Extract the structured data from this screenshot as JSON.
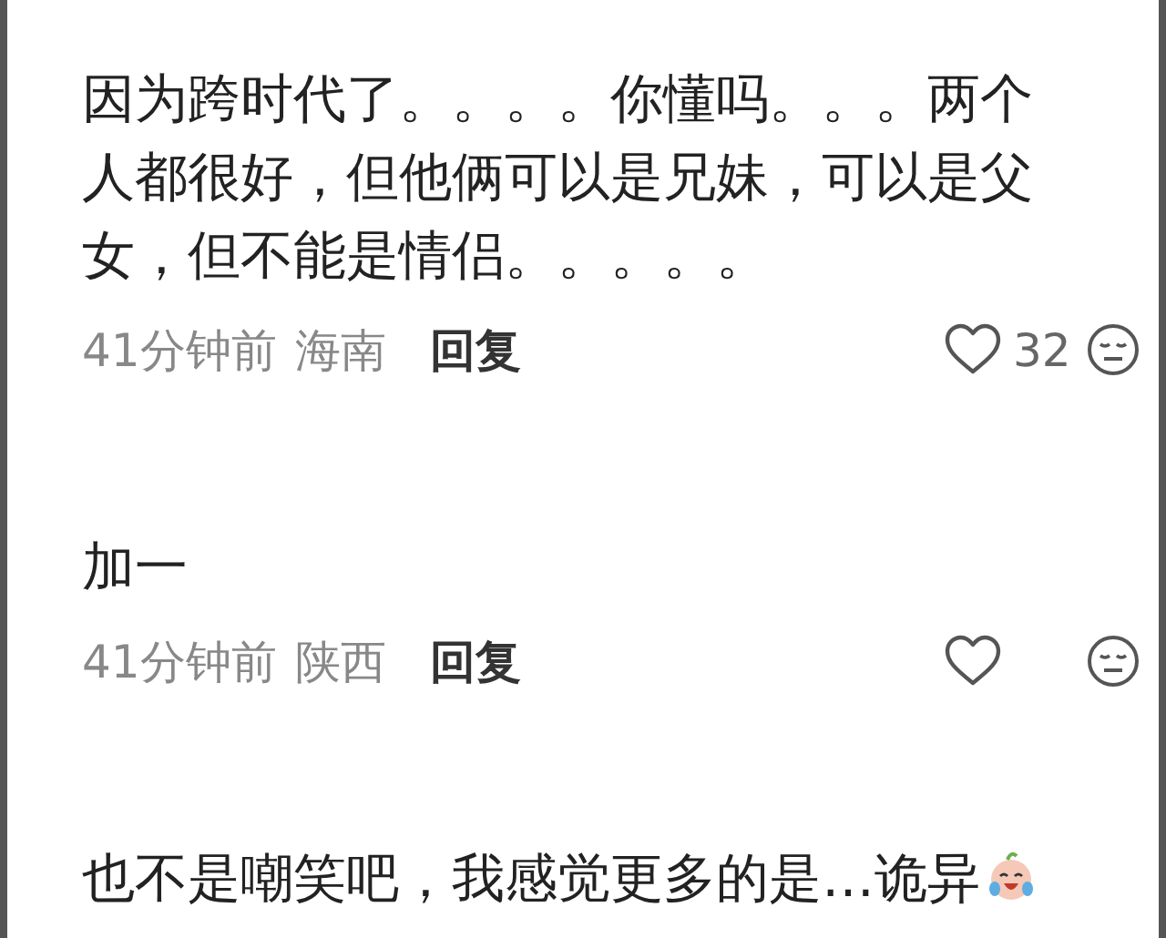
{
  "comments": [
    {
      "text": "因为跨时代了。。。。你懂吗。。。两个人都很好，但他俩可以是兄妹，可以是父女，但不能是情侣。。。。。",
      "has_emoji": false,
      "meta": {
        "time": "41分钟前",
        "location": "海南",
        "reply": "回复",
        "liked": false,
        "like_count": "32"
      }
    },
    {
      "text": "加一",
      "has_emoji": false,
      "meta": {
        "time": "41分钟前",
        "location": "陕西",
        "reply": "回复",
        "liked": false
      }
    },
    {
      "text": "也不是嘲笑吧，我感觉更多的是…诡异",
      "has_emoji": true
    }
  ]
}
